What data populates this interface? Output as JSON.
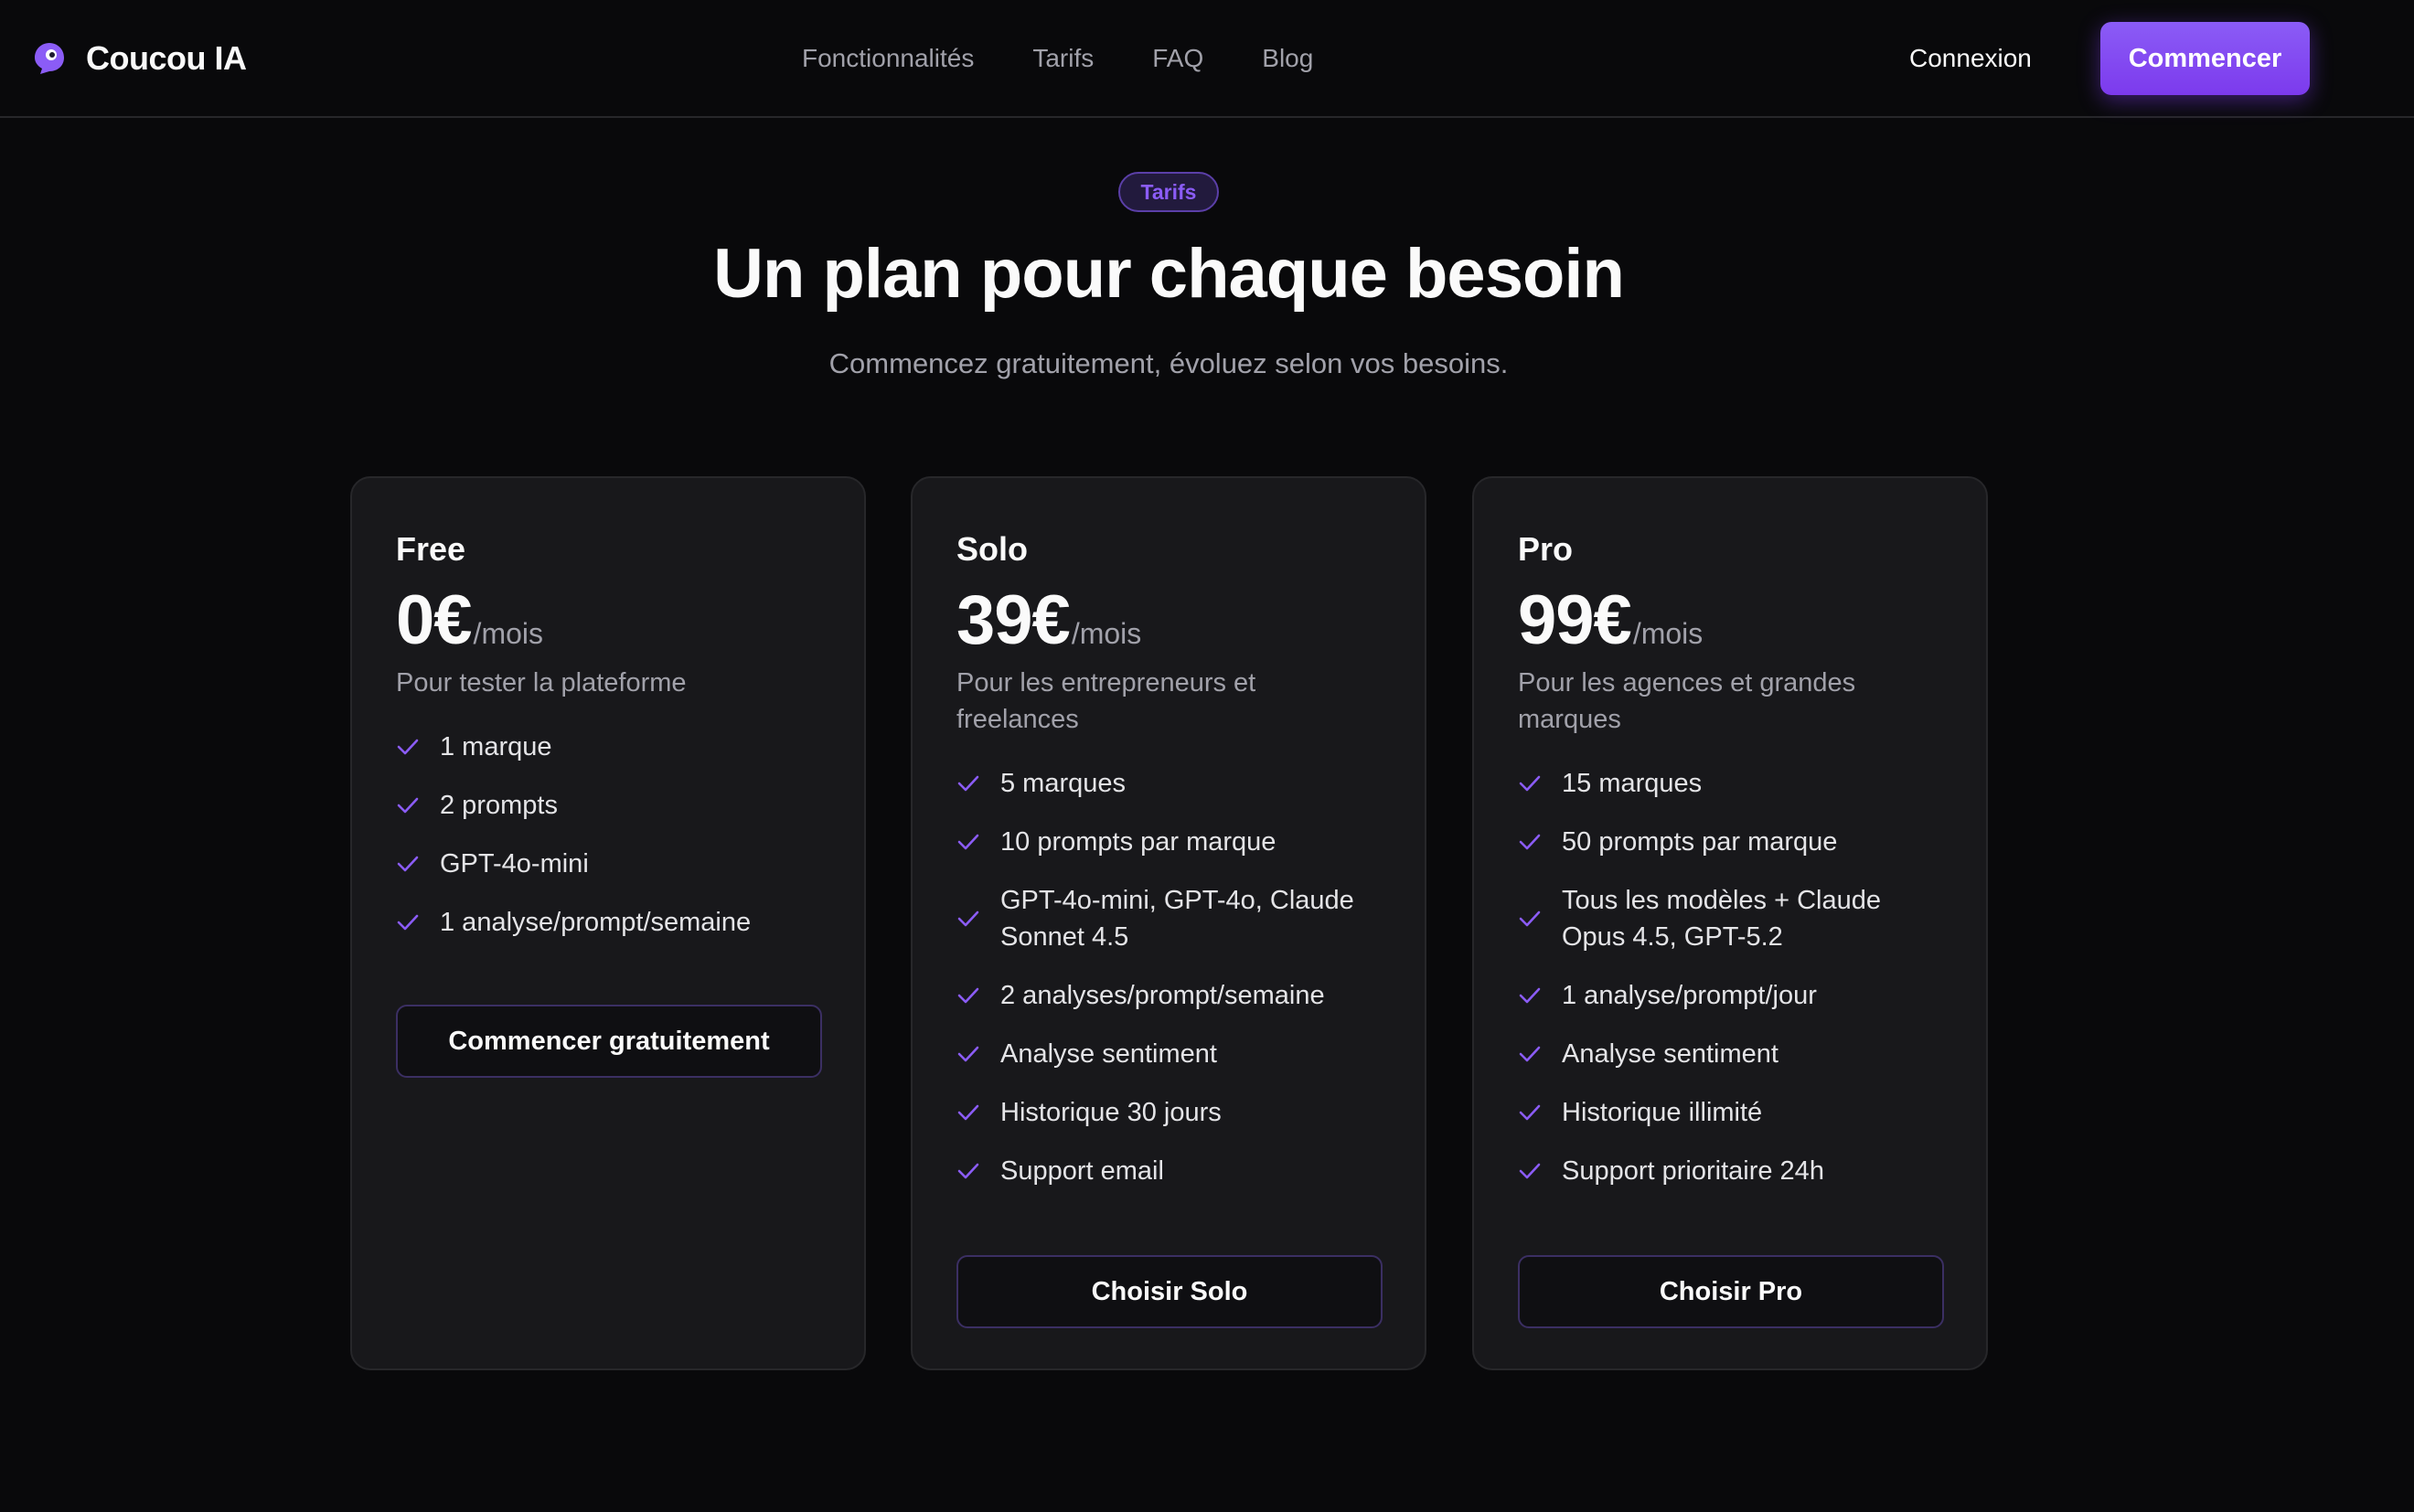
{
  "brand": {
    "name": "Coucou IA",
    "logo_icon": "chat-bubble-eye-icon",
    "accent": "#8b5cf6"
  },
  "nav": {
    "items": [
      {
        "label": "Fonctionnalités"
      },
      {
        "label": "Tarifs"
      },
      {
        "label": "FAQ"
      },
      {
        "label": "Blog"
      }
    ],
    "login_label": "Connexion",
    "cta_label": "Commencer"
  },
  "hero": {
    "badge": "Tarifs",
    "title": "Un plan pour chaque besoin",
    "subtitle": "Commencez gratuitement, évoluez selon vos besoins."
  },
  "plans": [
    {
      "name": "Free",
      "price": "0€",
      "period": "/mois",
      "description": "Pour tester la plateforme",
      "features": [
        "1 marque",
        "2 prompts",
        "GPT-4o-mini",
        "1 analyse/prompt/semaine"
      ],
      "button_label": "Commencer gratuitement"
    },
    {
      "name": "Solo",
      "price": "39€",
      "period": "/mois",
      "description": "Pour les entrepreneurs et freelances",
      "features": [
        "5 marques",
        "10 prompts par marque",
        "GPT-4o-mini, GPT-4o, Claude Sonnet 4.5",
        "2 analyses/prompt/semaine",
        "Analyse sentiment",
        "Historique 30 jours",
        "Support email"
      ],
      "button_label": "Choisir Solo"
    },
    {
      "name": "Pro",
      "price": "99€",
      "period": "/mois",
      "description": "Pour les agences et grandes marques",
      "features": [
        "15 marques",
        "50 prompts par marque",
        "Tous les modèles + Claude Opus 4.5, GPT-5.2",
        "1 analyse/prompt/jour",
        "Analyse sentiment",
        "Historique illimité",
        "Support prioritaire 24h"
      ],
      "button_label": "Choisir Pro"
    }
  ],
  "icons": {
    "feature": "check-icon"
  }
}
